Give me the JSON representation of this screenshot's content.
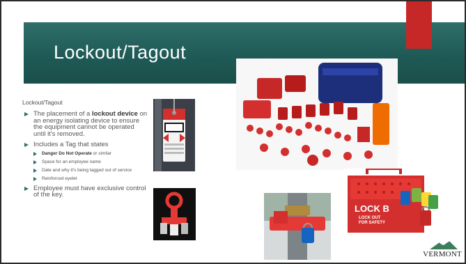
{
  "slide": {
    "title": "Lockout/Tagout",
    "subheading": "Lockout/Tagout",
    "bullets": {
      "b1_pre": "The placement of a ",
      "b1_bold": "lockout device",
      "b1_post": " on an energy isolating device to ensure the equipment cannot be operated until it's removed.",
      "b2": "Includes a Tag that states",
      "sub1_bold": "Danger Do Not Operate",
      "sub1_post": " or similar",
      "sub2": "Space for an employee name",
      "sub3": "Date and why it's being tagged out of service",
      "sub4": "Reinforced eyelet",
      "b3": "Employee must have exclusive control of the key."
    },
    "images": {
      "tag": "danger-tag-photo",
      "kit": "lockout-kit-photo",
      "hasp": "lockout-hasp-photo",
      "valve": "valve-lockout-photo",
      "box": "group-lock-box-photo"
    },
    "box_label": "LOCK B",
    "box_sub": "LOCK OUT\nFOR SAFETY",
    "logo_text": "VERMONT"
  },
  "colors": {
    "band": "#2f6e69",
    "accent": "#c62828"
  }
}
